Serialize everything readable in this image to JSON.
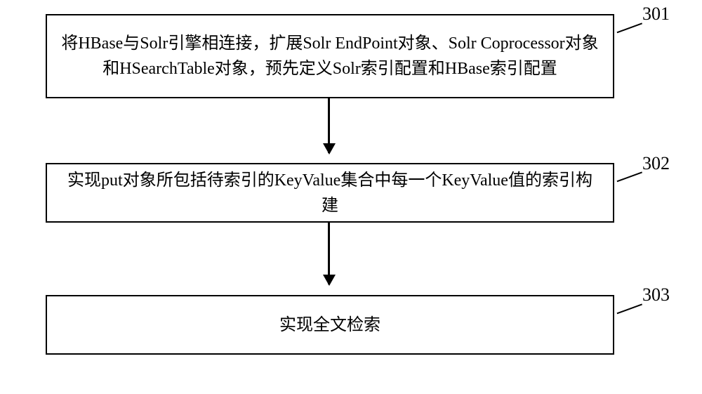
{
  "flowchart": {
    "steps": [
      {
        "id": "301",
        "text": "将HBase与Solr引擎相连接，扩展Solr EndPoint对象、Solr Coprocessor对象和HSearchTable对象，预先定义Solr索引配置和HBase索引配置"
      },
      {
        "id": "302",
        "text": "实现put对象所包括待索引的KeyValue集合中每一个KeyValue值的索引构建"
      },
      {
        "id": "303",
        "text": "实现全文检索"
      }
    ]
  }
}
